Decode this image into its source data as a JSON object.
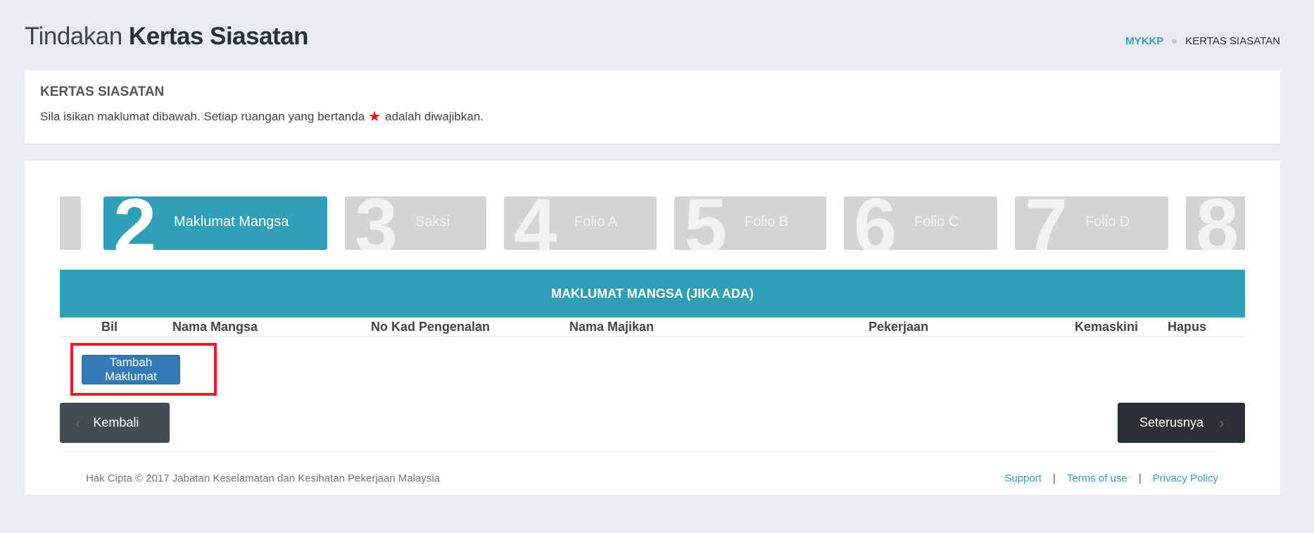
{
  "header": {
    "title_light": "Tindakan",
    "title_bold": "Kertas Siasatan",
    "breadcrumb": [
      {
        "label": "MYKKP"
      },
      {
        "label": "KERTAS SIASATAN"
      }
    ]
  },
  "info_card": {
    "heading": "KERTAS SIASATAN",
    "description_before": "Sila isikan maklumat dibawah. Setiap ruangan yang bertanda",
    "star_icon": "star-icon",
    "description_after": "adalah diwajibkan.",
    "star_color": "#e8141c"
  },
  "steps": [
    {
      "number": "",
      "label": ""
    },
    {
      "number": "2",
      "label": "Maklumat Mangsa",
      "active": true
    },
    {
      "number": "3",
      "label": "Saksi"
    },
    {
      "number": "4",
      "label": "Folio A"
    },
    {
      "number": "5",
      "label": "Folio B"
    },
    {
      "number": "6",
      "label": "Folio C"
    },
    {
      "number": "7",
      "label": "Folio D"
    },
    {
      "number": "8",
      "label": ""
    }
  ],
  "table": {
    "title": "MAKLUMAT MANGSA (JIKA ADA)",
    "columns": [
      "Bil",
      "Nama Mangsa",
      "No Kad Pengenalan",
      "Nama Majikan",
      "Pekerjaan",
      "Kemaskini",
      "Hapus"
    ],
    "rows": []
  },
  "actions": {
    "add_label": "Tambah Maklumat",
    "back_label": "Kembali",
    "next_label": "Seterusnya"
  },
  "footer": {
    "copyright": "Hak Cipta © 2017 Jabatan Keselamatan dan Kesihatan Pekerjaan Malaysia",
    "links": [
      "Support",
      "Terms of use",
      "Privacy Policy"
    ],
    "separator": "|"
  },
  "colors": {
    "accent": "#319fb6",
    "primary_button": "#337ab7",
    "highlight": "#e51d24",
    "step_inactive": "#d4d4d4"
  }
}
